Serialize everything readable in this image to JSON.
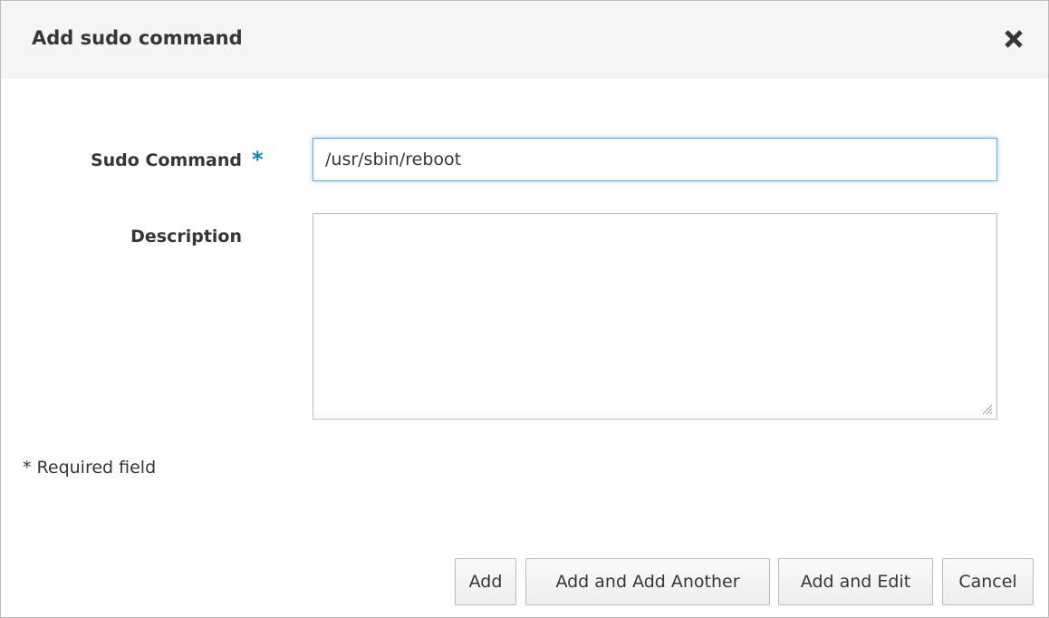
{
  "dialog": {
    "title": "Add sudo command",
    "close_icon": "close-icon"
  },
  "form": {
    "sudo_command": {
      "label": "Sudo Command",
      "required_marker": "*",
      "value": "/usr/sbin/reboot"
    },
    "description": {
      "label": "Description",
      "value": ""
    },
    "required_note": "* Required field"
  },
  "buttons": {
    "add": "Add",
    "add_another": "Add and Add Another",
    "add_edit": "Add and Edit",
    "cancel": "Cancel"
  },
  "colors": {
    "required_star": "#0088ce",
    "focus_border": "#66afe9",
    "header_background": "#f5f5f5"
  }
}
